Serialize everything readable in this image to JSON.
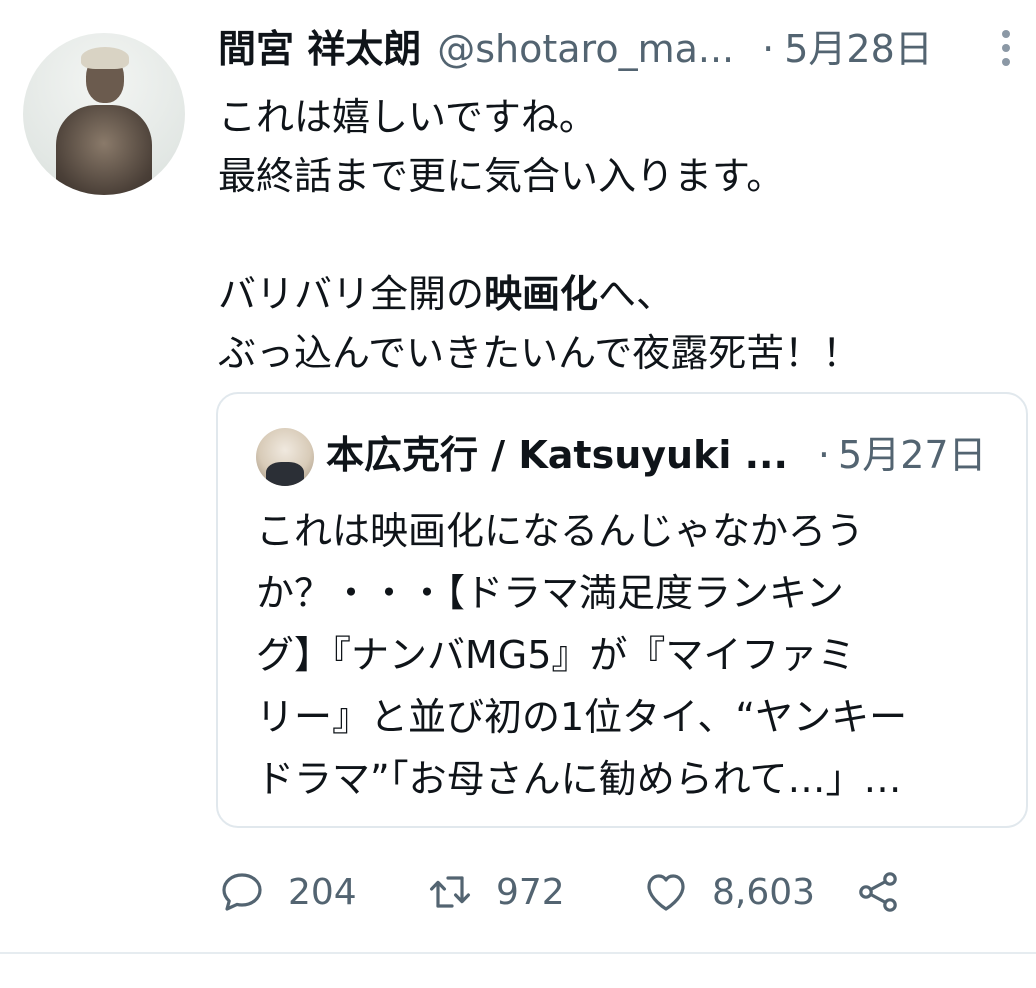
{
  "tweet": {
    "author_name": "間宮 祥太朗",
    "author_handle": "@shotaro_ma...",
    "separator": "·",
    "date": "5月28日",
    "text_lines": [
      "これは嬉しいですね。",
      "最終話まで更に気合い入ります。",
      "",
      "バリバリ全開の",
      "映画化",
      "へ、",
      "ぶっ込んでいきたいんで夜露死苦！！"
    ]
  },
  "quote": {
    "author": "本広克行 / Katsuyuki ...",
    "separator": "·",
    "date": "5月27日",
    "text": "これは映画化になるんじゃなかろう\nか？・・・【ドラマ満足度ランキン\nグ】『ナンバMG5』が『マイファミ\nリー』と並び初の1位タイ、“ヤンキー\nドラマ”「お母さんに勧められて…」…"
  },
  "actions": {
    "reply_count": "204",
    "retweet_count": "972",
    "like_count": "8,603"
  },
  "icons": {
    "reply": "reply-icon",
    "retweet": "retweet-icon",
    "like": "heart-icon",
    "share": "share-icon",
    "more": "more-vertical-icon"
  },
  "colors": {
    "text": "#0f1419",
    "secondary": "#536471",
    "border": "#e1e8ed"
  }
}
